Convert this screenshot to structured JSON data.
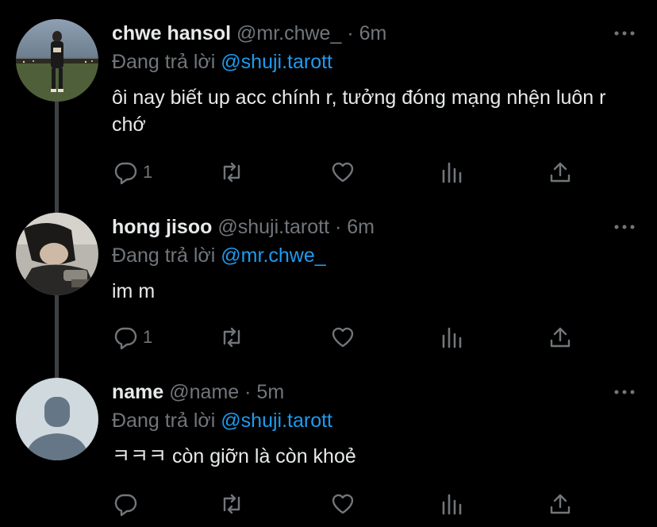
{
  "tweets": [
    {
      "name": "chwe hansol",
      "handle": "@mr.chwe_",
      "separator": "·",
      "time": "6m",
      "replying_prefix": "Đang trả lời",
      "replying_to": "@shuji.tarott",
      "text": "ôi nay biết up acc chính r, tưởng đóng mạng nhện luôn r chớ",
      "reply_count": "1",
      "avatar": "photo-person-standing"
    },
    {
      "name": "hong jisoo",
      "handle": "@shuji.tarott",
      "separator": "·",
      "time": "6m",
      "replying_prefix": "Đang trả lời",
      "replying_to": "@mr.chwe_",
      "text": "im m",
      "reply_count": "1",
      "avatar": "photo-person-closeup"
    },
    {
      "name": "name",
      "handle": "@name",
      "separator": "·",
      "time": "5m",
      "replying_prefix": "Đang trả lời",
      "replying_to": "@shuji.tarott",
      "text": "ㅋㅋㅋ còn giỡn là còn khoẻ",
      "reply_count": "",
      "avatar": "default-avatar"
    }
  ],
  "icons": [
    "reply-icon",
    "retweet-icon",
    "like-icon",
    "analytics-icon",
    "share-icon",
    "more-icon"
  ],
  "colors": {
    "background": "#000000",
    "text": "#e7e9ea",
    "muted": "#71767b",
    "accent": "#1d9bf0",
    "thread_line": "#3e4144"
  }
}
